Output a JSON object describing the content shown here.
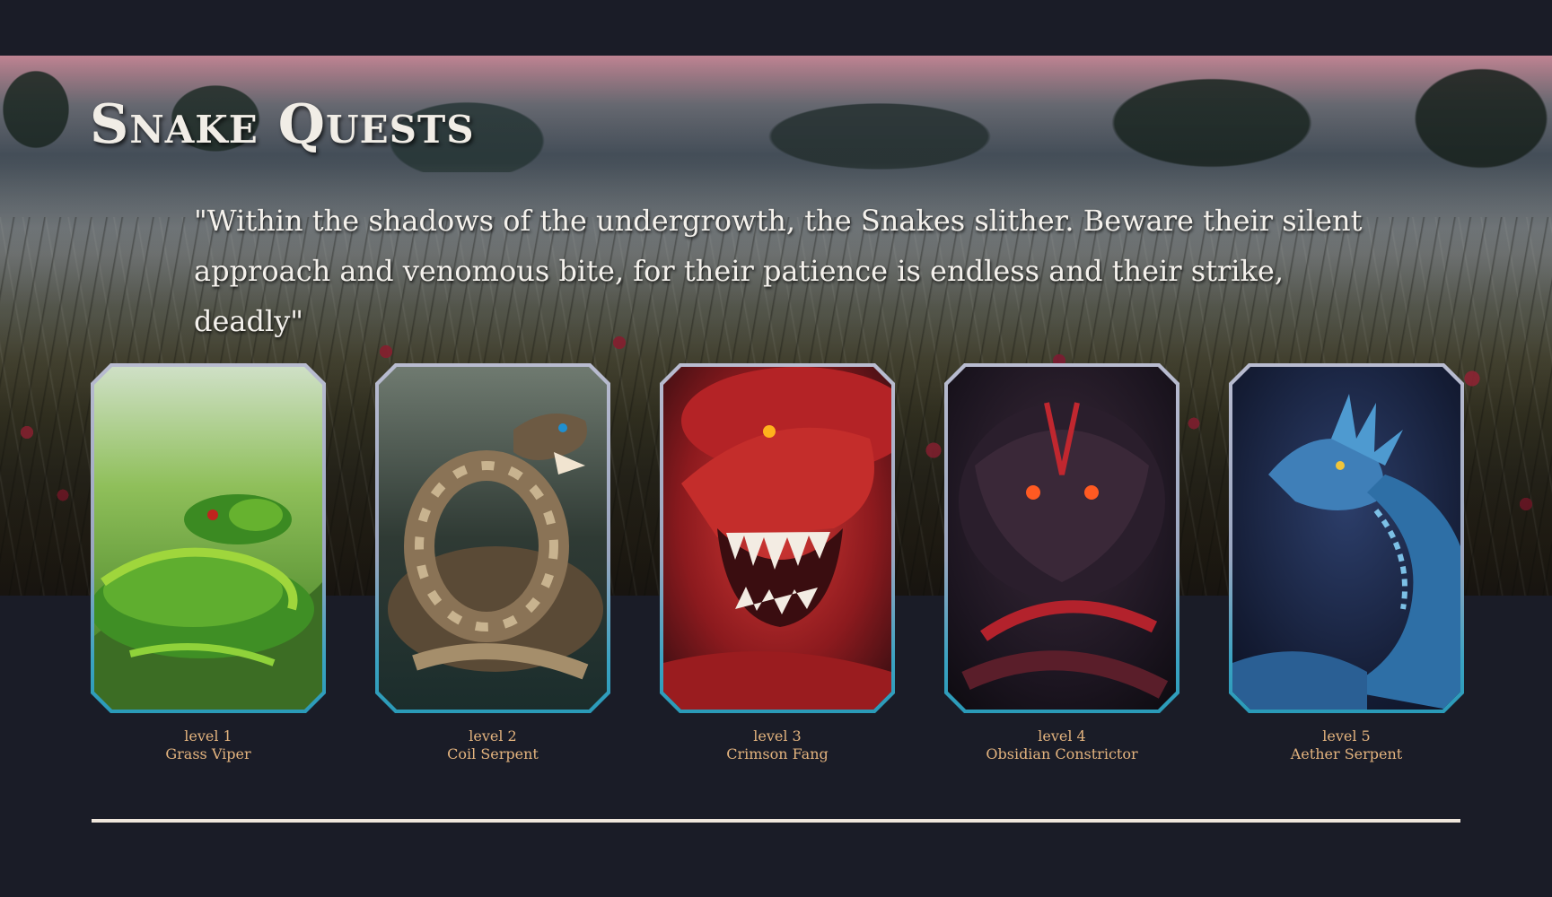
{
  "page": {
    "title": "Snake Quests",
    "quote": "\"Within the shadows of the undergrowth, the Snakes slither. Beware their silent approach and venomous bite, for their patience is endless and their strike, deadly\""
  },
  "cards": [
    {
      "level": "level 1",
      "name": "Grass Viper"
    },
    {
      "level": "level 2",
      "name": "Coil Serpent"
    },
    {
      "level": "level 3",
      "name": "Crimson Fang"
    },
    {
      "level": "level 4",
      "name": "Obsidian Constrictor"
    },
    {
      "level": "level 5",
      "name": "Aether Serpent"
    }
  ],
  "colors": {
    "background": "#1a1c27",
    "caption": "#e3b37e",
    "title": "#f1ede6",
    "card_border_bottom": "#2a9ab8",
    "divider": "#efe6dc"
  },
  "icons": {
    "hero_background": "marsh-landscape-image",
    "card_art": [
      "green-snake-illustration",
      "brown-coiled-snake-illustration",
      "red-fanged-snake-illustration",
      "black-red-snake-illustration",
      "blue-dragon-serpent-illustration"
    ]
  }
}
